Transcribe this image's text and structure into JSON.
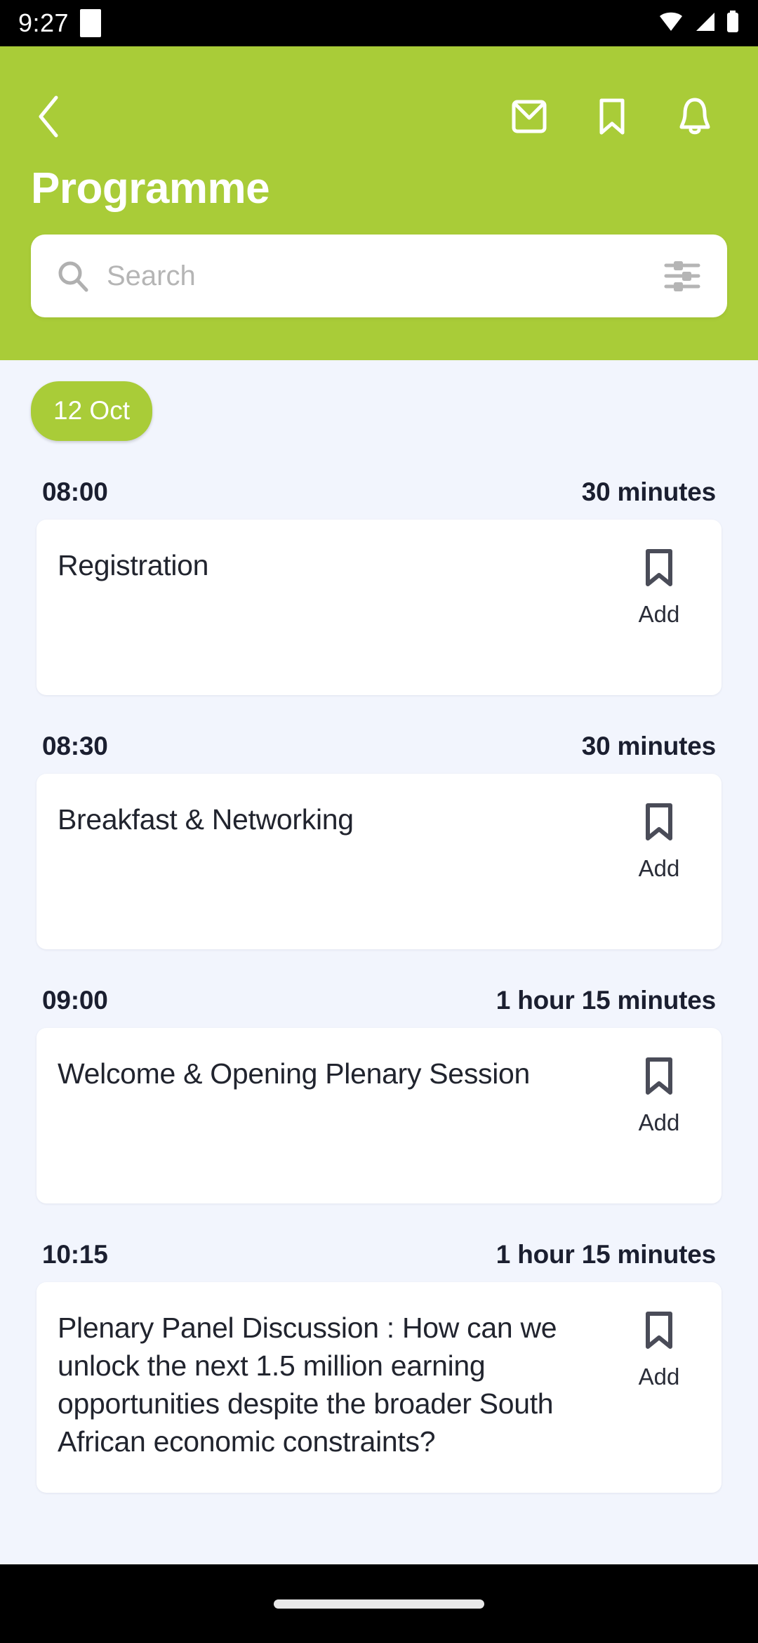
{
  "status_bar": {
    "time": "9:27",
    "icons": [
      "app-indicator",
      "wifi-icon",
      "signal-icon",
      "battery-icon"
    ]
  },
  "header": {
    "title": "Programme",
    "back_icon": "chevron-left-icon",
    "actions": [
      {
        "name": "mail-icon",
        "label": "Mail"
      },
      {
        "name": "bookmark-icon",
        "label": "Bookmarks"
      },
      {
        "name": "bell-icon",
        "label": "Notifications"
      }
    ],
    "accent_color": "#a9cc38"
  },
  "search": {
    "placeholder": "Search",
    "value": "",
    "search_icon": "search-icon",
    "filter_icon": "filter-sliders-icon"
  },
  "day_tabs": [
    {
      "label": "12 Oct",
      "selected": true
    }
  ],
  "sessions": [
    {
      "time": "08:00",
      "duration": "30 minutes",
      "title": "Registration",
      "action_label": "Add",
      "bookmarked": false
    },
    {
      "time": "08:30",
      "duration": "30 minutes",
      "title": "Breakfast & Networking",
      "action_label": "Add",
      "bookmarked": false
    },
    {
      "time": "09:00",
      "duration": "1 hour 15 minutes",
      "title": "Welcome & Opening Plenary Session",
      "action_label": "Add",
      "bookmarked": false
    },
    {
      "time": "10:15",
      "duration": "1 hour 15 minutes",
      "title": "Plenary Panel Discussion : How can we unlock the next 1.5 million earning opportunities despite the broader South African economic constraints?",
      "action_label": "Add",
      "bookmarked": false
    }
  ],
  "nav_bar": {
    "gesture_pill": true
  }
}
